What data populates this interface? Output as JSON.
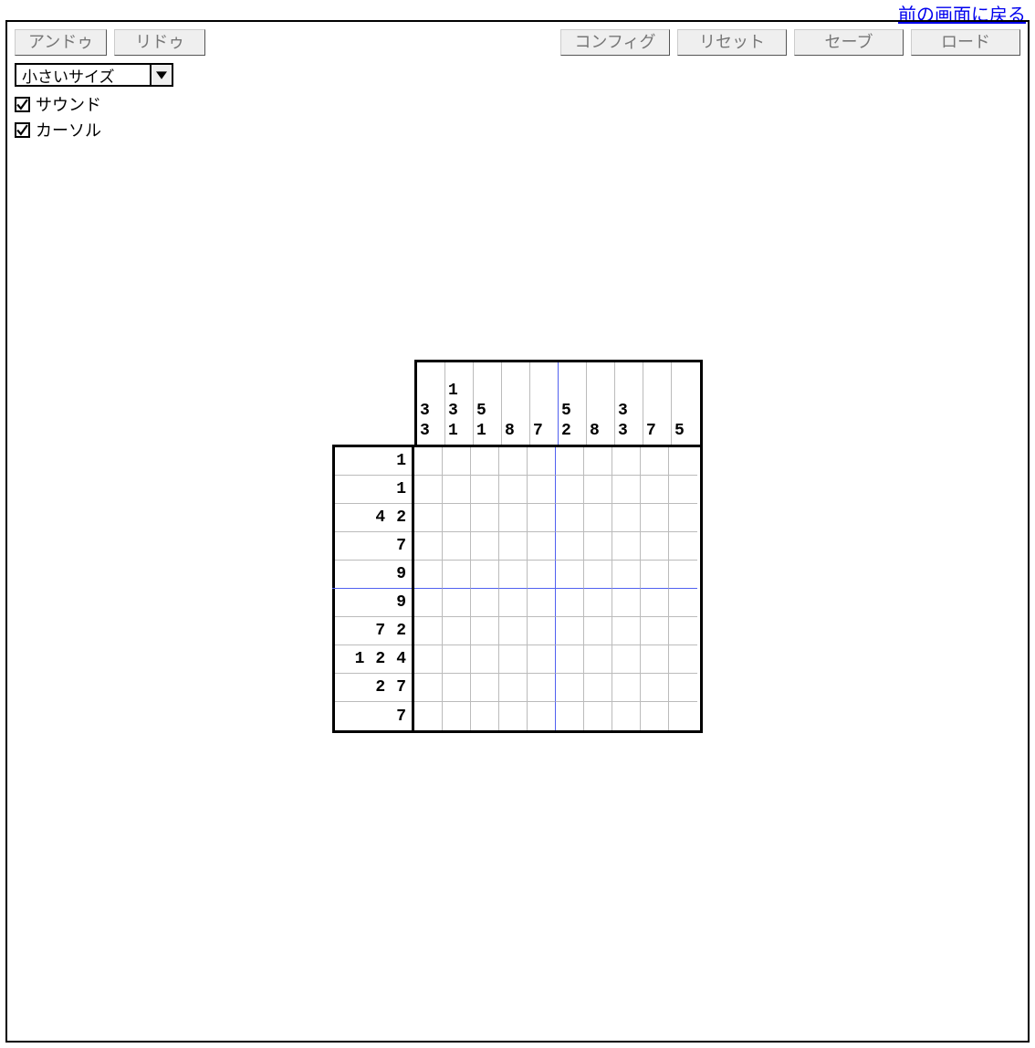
{
  "back_link": "前の画面に戻る",
  "toolbar": {
    "undo": "アンドゥ",
    "redo": "リドゥ",
    "config": "コンフィグ",
    "reset": "リセット",
    "save": "セーブ",
    "load": "ロード"
  },
  "size_select": {
    "value": "小さいサイズ"
  },
  "checkboxes": {
    "sound": {
      "label": "サウンド",
      "checked": true
    },
    "cursor": {
      "label": "カーソル",
      "checked": true
    }
  },
  "puzzle": {
    "cols": 10,
    "rows": 10,
    "col_clues": [
      [
        3,
        3
      ],
      [
        1,
        3,
        1
      ],
      [
        5,
        1
      ],
      [
        8
      ],
      [
        7
      ],
      [
        5,
        2
      ],
      [
        8
      ],
      [
        3,
        3
      ],
      [
        7
      ],
      [
        5
      ]
    ],
    "row_clues": [
      [
        1
      ],
      [
        1
      ],
      [
        4,
        2
      ],
      [
        7
      ],
      [
        9
      ],
      [
        9
      ],
      [
        7,
        2
      ],
      [
        1,
        2,
        4
      ],
      [
        2,
        7
      ],
      [
        7
      ]
    ]
  }
}
